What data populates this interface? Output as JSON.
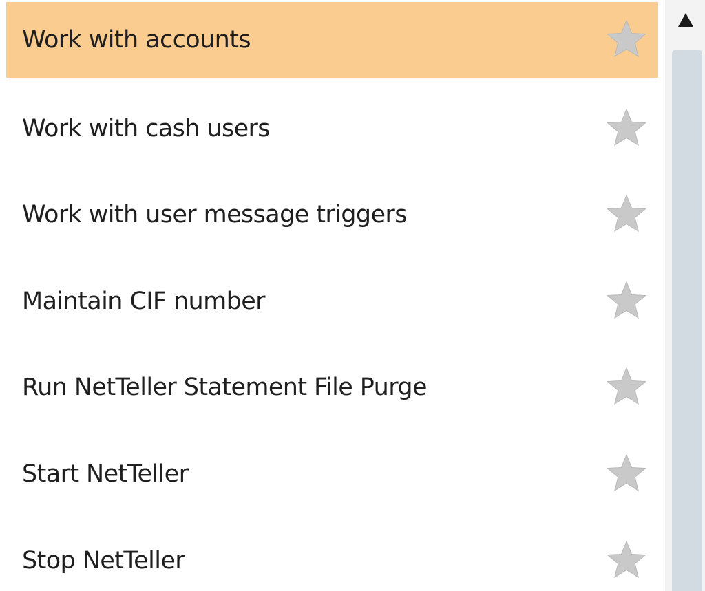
{
  "menu": {
    "items": [
      {
        "label": "Work with accounts",
        "selected": true,
        "favorite": false
      },
      {
        "label": "Work with cash users",
        "selected": false,
        "favorite": false
      },
      {
        "label": "Work with user message triggers",
        "selected": false,
        "favorite": false
      },
      {
        "label": "Maintain CIF number",
        "selected": false,
        "favorite": false
      },
      {
        "label": "Run NetTeller Statement File Purge",
        "selected": false,
        "favorite": false
      },
      {
        "label": "Start NetTeller",
        "selected": false,
        "favorite": false
      },
      {
        "label": "Stop NetTeller",
        "selected": false,
        "favorite": false
      }
    ]
  },
  "icons": {
    "favorite": "star-icon",
    "scroll_up": "triangle-up-icon"
  },
  "colors": {
    "selected_background": "#fbcc8f",
    "star_fill": "#c9c9c9",
    "scroll_thumb": "#d3dbe2",
    "scroll_track": "#f3f3f3",
    "text": "#1f1f1f"
  }
}
